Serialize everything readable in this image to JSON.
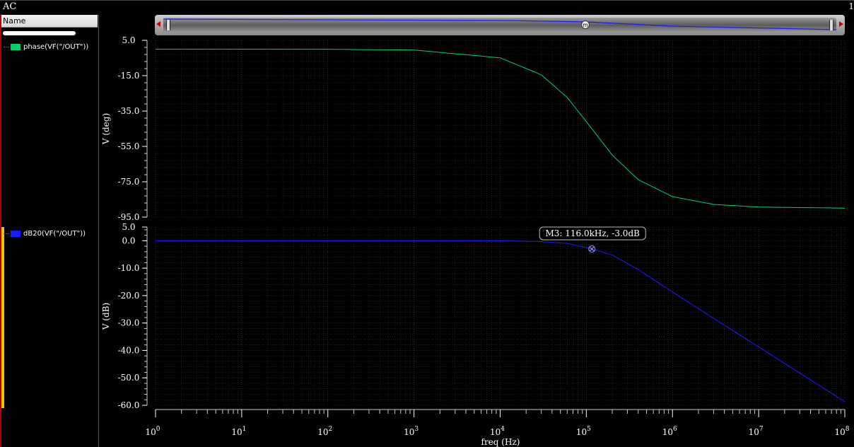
{
  "window": {
    "title": "AC",
    "corner_text": "1"
  },
  "name_panel": {
    "header": "Name",
    "traces": [
      {
        "label": "phase(VF(\"/OUT\"))",
        "color": "#00d06a"
      },
      {
        "label": "dB20(VF(\"/OUT\"))",
        "color": "#1a1aff"
      }
    ]
  },
  "zoom_scroller": {
    "center_icon": "m"
  },
  "x_axis": {
    "label": "freq (Hz)",
    "ticks": [
      {
        "base": "10",
        "exp": "0"
      },
      {
        "base": "10",
        "exp": "1"
      },
      {
        "base": "10",
        "exp": "2"
      },
      {
        "base": "10",
        "exp": "3"
      },
      {
        "base": "10",
        "exp": "4"
      },
      {
        "base": "10",
        "exp": "5"
      },
      {
        "base": "10",
        "exp": "6"
      },
      {
        "base": "10",
        "exp": "7"
      },
      {
        "base": "10",
        "exp": "8"
      }
    ]
  },
  "phase_plot": {
    "ylabel": "V (deg)",
    "yticks": [
      "5.0",
      "-15.0",
      "-35.0",
      "-55.0",
      "-75.0",
      "-95.0"
    ]
  },
  "db_plot": {
    "ylabel": "V (dB)",
    "yticks": [
      "5.0",
      "0.0",
      "-10.0",
      "-20.0",
      "-30.0",
      "-40.0",
      "-50.0",
      "-60.0"
    ]
  },
  "marker": {
    "label": "M3: 116.0kHz, -3.0dB"
  },
  "chart_data": [
    {
      "type": "line",
      "series": [
        {
          "name": "phase(VF(\"/OUT\"))",
          "color": "#00d06a",
          "x": [
            1,
            10,
            100,
            1000,
            10000,
            30000,
            60000,
            116000,
            200000,
            400000,
            1000000,
            3000000,
            10000000,
            100000000
          ],
          "y": [
            -0.0005,
            -0.005,
            -0.05,
            -0.5,
            -4.9,
            -14.5,
            -27.3,
            -45.0,
            -59.9,
            -73.8,
            -83.4,
            -87.8,
            -89.3,
            -89.9
          ]
        }
      ],
      "xscale": "log",
      "xlim": [
        1,
        100000000
      ],
      "ylim": [
        -95,
        5
      ],
      "xlabel": "freq (Hz)",
      "ylabel": "V (deg)"
    },
    {
      "type": "line",
      "series": [
        {
          "name": "dB20(VF(\"/OUT\"))",
          "color": "#1a1aff",
          "x": [
            1,
            10,
            100,
            1000,
            10000,
            30000,
            60000,
            116000,
            200000,
            400000,
            1000000,
            3000000,
            10000000,
            100000000
          ],
          "y": [
            0,
            0,
            0,
            0,
            -0.03,
            -0.28,
            -0.97,
            -3.0,
            -5.2,
            -10.5,
            -18.7,
            -28.3,
            -38.7,
            -58.7
          ]
        }
      ],
      "xscale": "log",
      "xlim": [
        1,
        100000000
      ],
      "ylim": [
        -60,
        5
      ],
      "xlabel": "freq (Hz)",
      "ylabel": "V (dB)",
      "annotations": [
        {
          "label": "M3: 116.0kHz, -3.0dB",
          "x": 116000,
          "y": -3.0
        }
      ]
    }
  ]
}
